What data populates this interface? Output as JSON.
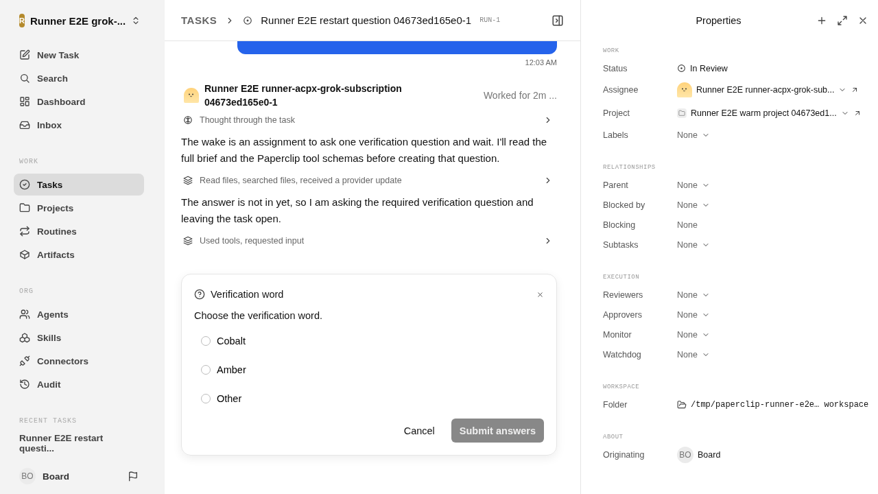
{
  "workspace": {
    "name": "Runner E2E grok-...",
    "initial": "R"
  },
  "nav": [
    {
      "label": "New Task",
      "selected": false
    },
    {
      "label": "Search",
      "selected": false
    },
    {
      "label": "Dashboard",
      "selected": false
    },
    {
      "label": "Inbox",
      "selected": false
    }
  ],
  "sections": [
    {
      "title": "WORK",
      "items": [
        {
          "label": "Tasks",
          "selected": true
        },
        {
          "label": "Projects",
          "selected": false
        },
        {
          "label": "Routines",
          "selected": false
        },
        {
          "label": "Artifacts",
          "selected": false
        }
      ]
    },
    {
      "title": "ORG",
      "items": [
        {
          "label": "Agents",
          "selected": false
        },
        {
          "label": "Skills",
          "selected": false
        },
        {
          "label": "Connectors",
          "selected": false
        },
        {
          "label": "Audit",
          "selected": false
        }
      ]
    }
  ],
  "recent": {
    "title": "RECENT TASKS",
    "items": [
      "Runner E2E restart questi..."
    ]
  },
  "user": {
    "initials": "BO",
    "name": "Board"
  },
  "breadcrumb": {
    "root": "TASKS",
    "title": "Runner E2E restart question 04673ed165e0-1",
    "run": "RUN-1"
  },
  "message_time": "12:03 AM",
  "agent": {
    "name": "Runner E2E runner-acpx-grok-subscription 04673ed165e0-1",
    "worked": "Worked for 2m ..."
  },
  "transcript": [
    {
      "kind": "step",
      "text": "Thought through the task"
    },
    {
      "kind": "text",
      "text": "The wake is an assignment to ask one verification question and wait. I'll read the full brief and the Paperclip tool schemas before creating that question."
    },
    {
      "kind": "step",
      "text": "Read files, searched files, received a provider update"
    },
    {
      "kind": "text",
      "text": "The answer is not in yet, so I am asking the required verification question and leaving the task open."
    },
    {
      "kind": "step",
      "text": "Used tools, requested input"
    }
  ],
  "question": {
    "title": "Verification word",
    "prompt": "Choose the verification word.",
    "options": [
      {
        "label": "Cobalt",
        "selected": false
      },
      {
        "label": "Amber",
        "selected": false
      },
      {
        "label": "Other",
        "selected": false
      }
    ],
    "cancel": "Cancel",
    "submit": {
      "label": "Submit answers",
      "disabled": true
    }
  },
  "properties": {
    "title": "Properties",
    "groups": [
      {
        "title": "WORK",
        "rows": [
          {
            "label": "Status",
            "kind": "status",
            "value": "In Review"
          },
          {
            "label": "Assignee",
            "kind": "agent",
            "value": "Runner E2E runner-acpx-grok-sub..."
          },
          {
            "label": "Project",
            "kind": "project",
            "value": "Runner E2E warm project 04673ed1..."
          },
          {
            "label": "Labels",
            "kind": "select",
            "value": "None"
          }
        ]
      },
      {
        "title": "RELATIONSHIPS",
        "rows": [
          {
            "label": "Parent",
            "kind": "select",
            "value": "None"
          },
          {
            "label": "Blocked by",
            "kind": "select",
            "value": "None"
          },
          {
            "label": "Blocking",
            "kind": "plain",
            "value": "None"
          },
          {
            "label": "Subtasks",
            "kind": "select",
            "value": "None"
          }
        ]
      },
      {
        "title": "EXECUTION",
        "rows": [
          {
            "label": "Reviewers",
            "kind": "select",
            "value": "None"
          },
          {
            "label": "Approvers",
            "kind": "select",
            "value": "None"
          },
          {
            "label": "Monitor",
            "kind": "select",
            "value": "None"
          },
          {
            "label": "Watchdog",
            "kind": "select",
            "value": "None"
          }
        ]
      },
      {
        "title": "WORKSPACE",
        "rows": [
          {
            "label": "Folder",
            "kind": "folder",
            "value": "/tmp/paperclip-runner-e2e… workspace"
          }
        ]
      },
      {
        "title": "ABOUT",
        "rows": [
          {
            "label": "Originating",
            "kind": "user",
            "initials": "BO",
            "value": "Board"
          }
        ]
      }
    ]
  }
}
